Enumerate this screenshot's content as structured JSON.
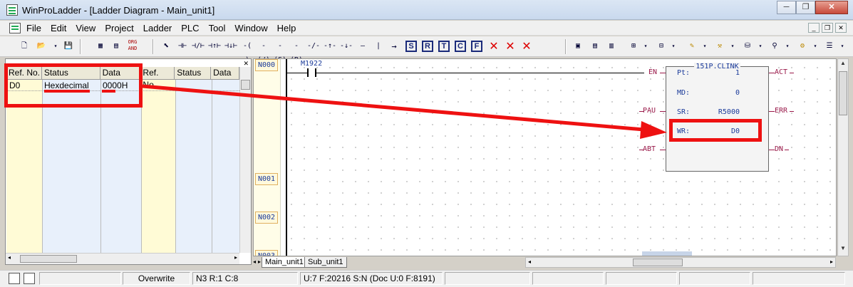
{
  "window": {
    "title": "WinProLadder - [Ladder Diagram - Main_unit1]",
    "minimize": "─",
    "restore": "❐",
    "close": "✕"
  },
  "menu": [
    "File",
    "Edit",
    "View",
    "Project",
    "Ladder",
    "PLC",
    "Tool",
    "Window",
    "Help"
  ],
  "mdi_buttons": {
    "minimize": "_",
    "restore": "❐",
    "close": "✕"
  },
  "toolbar": {
    "org_and": "ORG AND",
    "contact_labels": [
      "A",
      "B",
      "U",
      "D",
      "",
      "",
      "",
      "R",
      "I",
      "P",
      "N",
      "H",
      "v"
    ],
    "box_labels": [
      "S",
      "R",
      "T",
      "C",
      "F"
    ]
  },
  "monitor_table": {
    "close_glyph": "✕",
    "headers": [
      "Ref. No.",
      "Status",
      "Data",
      "Ref. No.",
      "Status",
      "Data"
    ],
    "rows": [
      {
        "ref": "D0",
        "status": "Hexdecimal",
        "data": "0000H"
      }
    ]
  },
  "ladder": {
    "rungs": [
      "N000",
      "N001",
      "N002",
      "N003"
    ],
    "contact_label": "M1922",
    "function_block": {
      "name": "151P.CLINK",
      "params": [
        {
          "label": "Pt:",
          "value": "1"
        },
        {
          "label": "MD:",
          "value": "0"
        },
        {
          "label": "SR:",
          "value": "R5000"
        },
        {
          "label": "WR:",
          "value": "D0"
        }
      ],
      "inputs": [
        "EN",
        "PAU",
        "ABT"
      ],
      "outputs": [
        "ACT",
        "ERR",
        "DN"
      ]
    }
  },
  "tabs": [
    "Main_unit1",
    "Sub_unit1"
  ],
  "statusbar": {
    "mode": "Overwrite",
    "cursor": "N3 R:1 C:8",
    "info": "U:7 F:20216 S:N (Doc U:0 F:8191)"
  },
  "annotation_color": "#ee1111"
}
